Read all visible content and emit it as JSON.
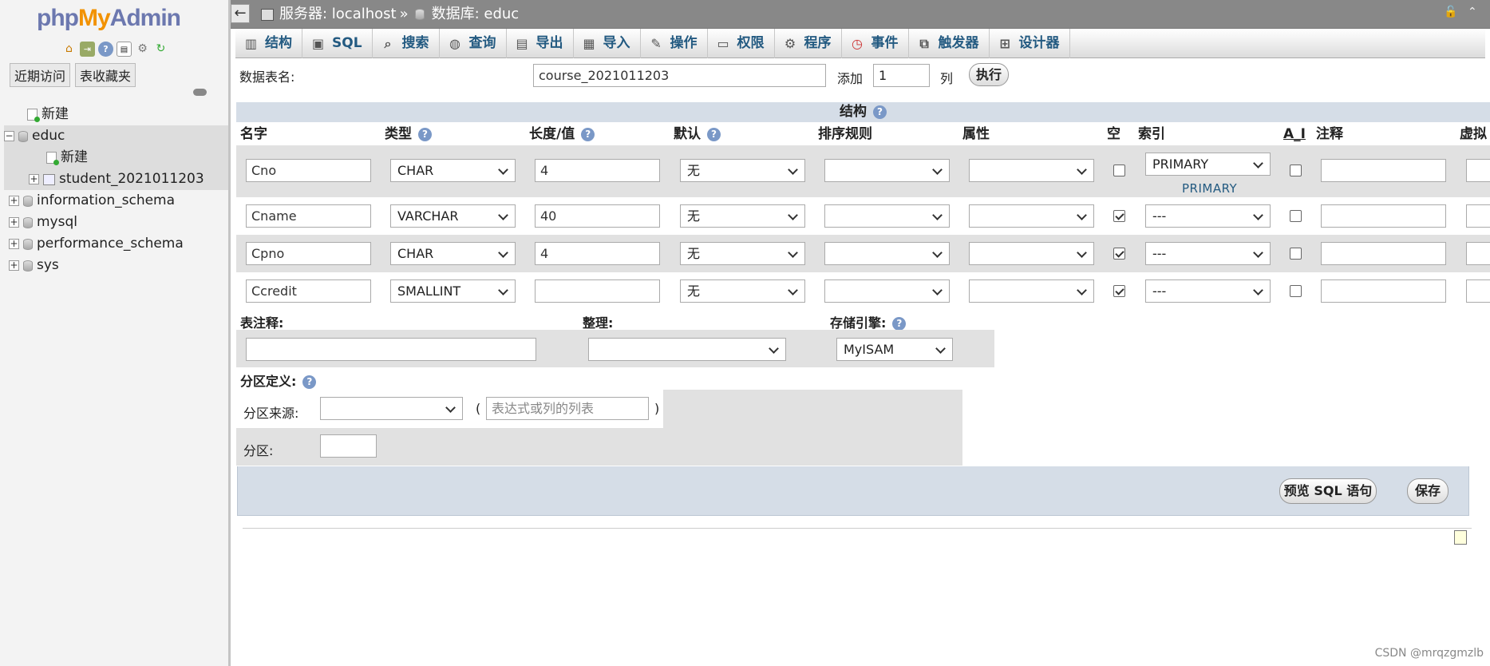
{
  "logo": {
    "php": "php",
    "my": "My",
    "admin": "Admin"
  },
  "sidebar": {
    "tabs": [
      "近期访问",
      "表收藏夹"
    ],
    "tree": [
      {
        "label": "新建"
      },
      {
        "label": "educ"
      },
      {
        "label": "新建"
      },
      {
        "label": "student_2021011203"
      },
      {
        "label": "information_schema"
      },
      {
        "label": "mysql"
      },
      {
        "label": "performance_schema"
      },
      {
        "label": "sys"
      }
    ]
  },
  "topbar": {
    "server": "服务器: localhost",
    "sep": "»",
    "database": "数据库: educ"
  },
  "menu": [
    "结构",
    "SQL",
    "搜索",
    "查询",
    "导出",
    "导入",
    "操作",
    "权限",
    "程序",
    "事件",
    "触发器",
    "设计器"
  ],
  "form": {
    "table_name_label": "数据表名:",
    "table_name_value": "course_2021011203",
    "add_label": "添加",
    "add_value": "1",
    "col_label": "列",
    "go_label": "执行"
  },
  "structure_title": "结构",
  "columns": [
    "名字",
    "类型",
    "长度/值",
    "默认",
    "排序规则",
    "属性",
    "空",
    "索引",
    "A_I",
    "注释",
    "虚拟"
  ],
  "fields": [
    {
      "name": "Cno",
      "type": "CHAR",
      "length": "4",
      "default": "无",
      "null": false,
      "index": "PRIMARY",
      "index_note": "PRIMARY",
      "ai": false
    },
    {
      "name": "Cname",
      "type": "VARCHAR",
      "length": "40",
      "default": "无",
      "null": true,
      "index": "---",
      "index_note": "",
      "ai": false
    },
    {
      "name": "Cpno",
      "type": "CHAR",
      "length": "4",
      "default": "无",
      "null": true,
      "index": "---",
      "index_note": "",
      "ai": false
    },
    {
      "name": "Ccredit",
      "type": "SMALLINT",
      "length": "",
      "default": "无",
      "null": true,
      "index": "---",
      "index_note": "",
      "ai": false
    }
  ],
  "table_options": {
    "comment_label": "表注释:",
    "collation_label": "整理:",
    "engine_label": "存储引擎:",
    "engine_value": "MyISAM"
  },
  "partition": {
    "title": "分区定义:",
    "source_label": "分区来源:",
    "expr_placeholder": "表达式或列的列表",
    "open_paren": "(",
    "close_paren": ")",
    "partitions_label": "分区:"
  },
  "buttons": {
    "preview_sql": "预览 SQL 语句",
    "save": "保存"
  },
  "watermark": "CSDN @mrqzgmzlb"
}
